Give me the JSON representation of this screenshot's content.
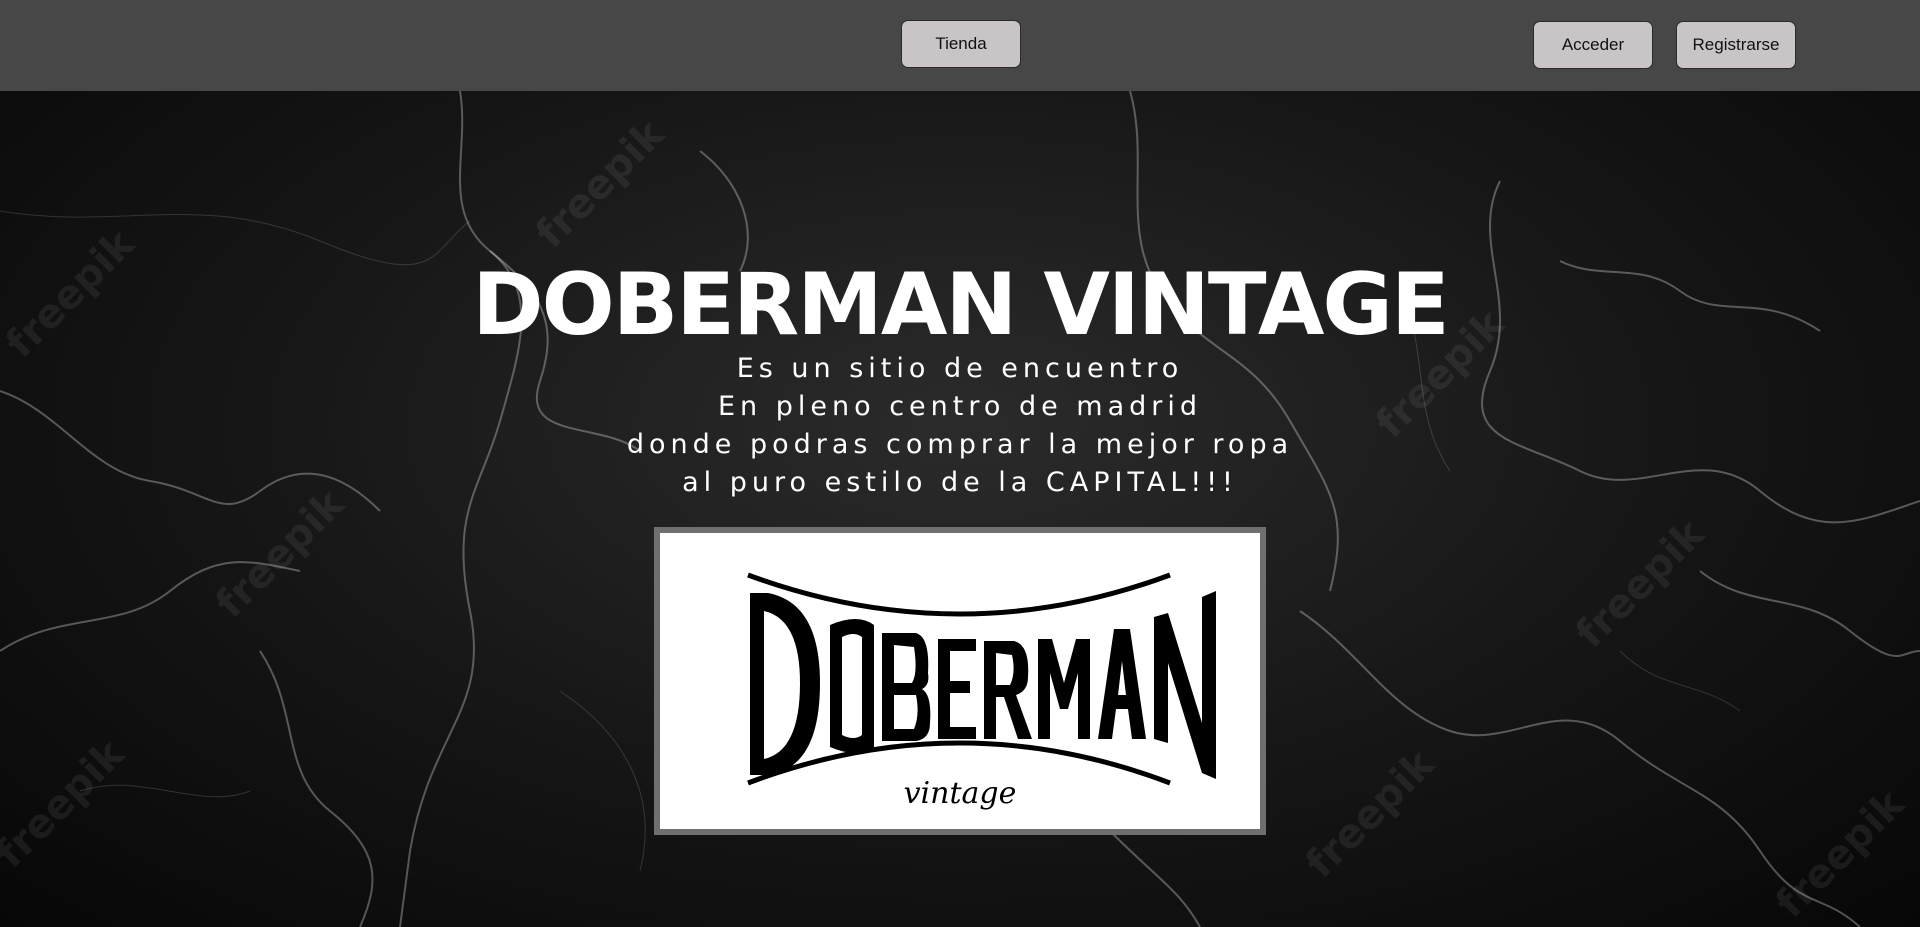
{
  "nav": {
    "tienda_label": "Tienda",
    "acceder_label": "Acceder",
    "registrarse_label": "Registrarse"
  },
  "hero": {
    "title": "DOBERMAN VINTAGE",
    "tagline": [
      "Es un sitio de encuentro",
      "En pleno centro de madrid",
      "donde podras comprar la mejor ropa",
      "al puro estilo de la CAPITAL!!!"
    ],
    "background_watermark": "freepik",
    "logo": {
      "wordmark": "DOBERMAN",
      "script": "vintage"
    }
  },
  "colors": {
    "topbar": "#474747",
    "button": "#c9c4c5",
    "hero_text": "#ffffff",
    "logo_border": "#6f6f6f"
  }
}
